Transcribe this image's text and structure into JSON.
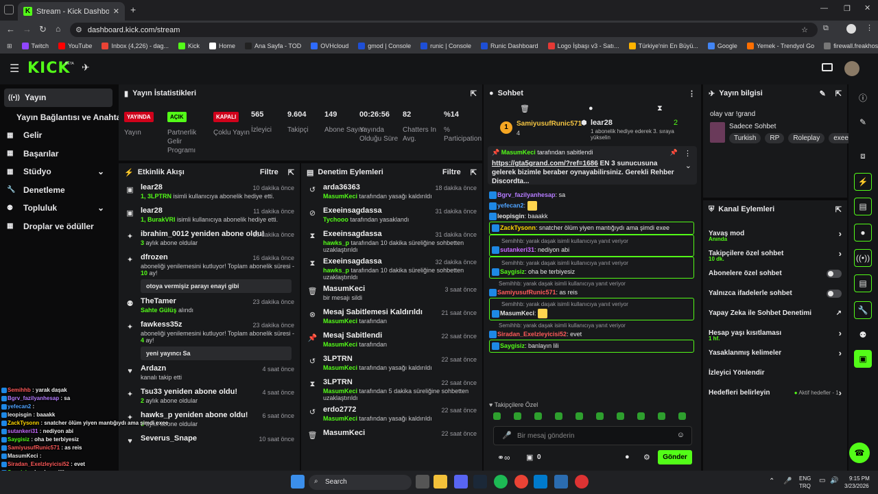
{
  "browser": {
    "tab_title": "Stream - Kick Dashboard",
    "url": "dashboard.kick.com/stream",
    "bookmarks": [
      {
        "label": "Twitch",
        "color": "#9146ff"
      },
      {
        "label": "YouTube",
        "color": "#ff0000"
      },
      {
        "label": "Inbox (4,226) - dag...",
        "color": "#ea4335"
      },
      {
        "label": "Kick",
        "color": "#53fc18"
      },
      {
        "label": "Home",
        "color": "#ffffff"
      },
      {
        "label": "Ana Sayfa - TOD",
        "color": "#222222"
      },
      {
        "label": "OVHcloud",
        "color": "#2e6bff"
      },
      {
        "label": "gmod | Console",
        "color": "#1e4fd6"
      },
      {
        "label": "runic | Console",
        "color": "#1e4fd6"
      },
      {
        "label": "Runic Dashboard",
        "color": "#1e4fd6"
      },
      {
        "label": "Logo İşbaşı v3 - Satı...",
        "color": "#e53935"
      },
      {
        "label": "Türkiye'nin En Büyü...",
        "color": "#ffb300"
      },
      {
        "label": "Google",
        "color": "#4285f4"
      },
      {
        "label": "Yemek - Trendyol Go",
        "color": "#ff6f00"
      },
      {
        "label": "firewall.freakhosting...",
        "color": "#777777"
      }
    ]
  },
  "topnav": {
    "logo": "KICK",
    "beta": "BETA"
  },
  "sidenav": {
    "items": [
      {
        "label": "Yayın",
        "icon": "broadcast-icon"
      },
      {
        "label": "Yayın Bağlantısı ve Anahtarı",
        "icon": ""
      },
      {
        "label": "Gelir",
        "icon": "revenue-icon"
      },
      {
        "label": "Başarılar",
        "icon": "achievements-icon"
      },
      {
        "label": "Stüdyo",
        "icon": "studio-icon"
      },
      {
        "label": "Denetleme",
        "icon": "moderation-icon"
      },
      {
        "label": "Topluluk",
        "icon": "community-icon"
      },
      {
        "label": "Droplar ve ödüller",
        "icon": "drops-icon"
      }
    ]
  },
  "stats": {
    "title": "Yayın İstatistikleri",
    "status": [
      {
        "badge": "YAYINDA",
        "label": "Yayın",
        "color": "#d0021b"
      },
      {
        "badge": "AÇIK",
        "label": "Partnerlik Gelir Programı",
        "color": "#53fc18"
      },
      {
        "badge": "KAPALI",
        "label": "Çoklu Yayın",
        "color": "#d0021b"
      }
    ],
    "metrics": [
      {
        "value": "565",
        "label": "İzleyici"
      },
      {
        "value": "9.604",
        "label": "Takipçi"
      },
      {
        "value": "149",
        "label": "Abone Sayısı"
      },
      {
        "value": "00:26:56",
        "label": "Yayında Olduğu Süre"
      },
      {
        "value": "82",
        "label": "Chatters In Avg."
      },
      {
        "value": "%14",
        "label": "% Participation"
      }
    ]
  },
  "activity": {
    "title": "Etkinlik Akışı",
    "filter": "Filtre",
    "items": [
      {
        "icon": "gift-icon",
        "name": "lear28",
        "time": "10 dakika önce",
        "hl": "1, 3LPTRN",
        "sub": " isimli kullanıcıya abonelik hediye etti."
      },
      {
        "icon": "gift-icon",
        "name": "lear28",
        "time": "11 dakika önce",
        "hl": "1, BurakVRI",
        "sub": " isimli kullanıcıya abonelik hediye etti."
      },
      {
        "icon": "star-icon",
        "name": "ibrahim_0012 yeniden abone oldu!",
        "time": "15 dakika önce",
        "hl": "3",
        "sub": " aylık abone oldular"
      },
      {
        "icon": "star-icon",
        "name": "dfrozen",
        "time": "16 dakika önce",
        "pre": "aboneliği yenilemesini kutluyor! Toplam abonelik süresi - ",
        "hl": "10",
        "sub": " ay!",
        "quote": "otoya vermişiz parayı enayi gibi"
      },
      {
        "icon": "kick-icon",
        "name": "TheTamer",
        "time": "23 dakika önce",
        "hl": "Sahte Gülüş",
        "sub": " alındı"
      },
      {
        "icon": "star-icon",
        "name": "fawkess35z",
        "time": "23 dakika önce",
        "pre": "aboneliği yenilemesini kutluyor! Toplam abonelik süresi - ",
        "hl": "4",
        "sub": " ay!",
        "quote": "yeni yayıncı Sa"
      },
      {
        "icon": "heart-icon",
        "name": "Ardazn",
        "time": "4 saat önce",
        "pre": "kanalı takip etti"
      },
      {
        "icon": "star-icon",
        "name": "Tsu33 yeniden abone oldu!",
        "time": "4 saat önce",
        "hl": "2",
        "sub": " aylık abone oldular"
      },
      {
        "icon": "star-icon",
        "name": "hawks_p yeniden abone oldu!",
        "time": "6 saat önce",
        "hl": "3",
        "sub": " aylık abone oldular"
      },
      {
        "icon": "heart-icon",
        "name": "Severus_Snape",
        "time": "10 saat önce"
      }
    ]
  },
  "modlog": {
    "title": "Denetim Eylemleri",
    "filter": "Filtre",
    "items": [
      {
        "icon": "undo-icon",
        "name": "arda36363",
        "time": "18 dakika önce",
        "hl": "MasumKeci",
        "sub": " tarafından yasağı kaldırıldı"
      },
      {
        "icon": "ban-icon",
        "name": "Exeeinsagdassa",
        "time": "31 dakika önce",
        "hl": "Tychooo",
        "sub": " tarafından yasaklandı"
      },
      {
        "icon": "hourglass-icon",
        "name": "Exeeinsagdassa",
        "time": "31 dakika önce",
        "hl": "hawks_p",
        "sub": " tarafından 10 dakika süreliğine sohbetten uzaklaştırıldı"
      },
      {
        "icon": "hourglass-icon",
        "name": "Exeeinsagdassa",
        "time": "32 dakika önce",
        "hl": "hawks_p",
        "sub": " tarafından 10 dakika süreliğine sohbetten uzaklaştırıldı"
      },
      {
        "icon": "trash-icon",
        "name": "MasumKeci",
        "time": "3 saat önce",
        "pre": "bir mesajı sildi"
      },
      {
        "icon": "unpin-icon",
        "name": "Mesaj Sabitlemesi Kaldırıldı",
        "time": "21 saat önce",
        "hl": "MasumKeci",
        "sub": " tarafından"
      },
      {
        "icon": "pin-icon",
        "name": "Mesaj Sabitlendi",
        "time": "22 saat önce",
        "hl": "MasumKeci",
        "sub": " tarafından"
      },
      {
        "icon": "undo-icon",
        "name": "3LPTRN",
        "time": "22 saat önce",
        "hl": "MasumKeci",
        "sub": " tarafından yasağı kaldırıldı"
      },
      {
        "icon": "hourglass-icon",
        "name": "3LPTRN",
        "time": "22 saat önce",
        "hl": "MasumKeci",
        "sub": " tarafından 5 dakika süreliğine sohbetten uzaklaştırıldı"
      },
      {
        "icon": "undo-icon",
        "name": "erdo2772",
        "time": "22 saat önce",
        "hl": "MasumKeci",
        "sub": " tarafından yasağı kaldırıldı"
      },
      {
        "icon": "trash-icon",
        "name": "MasumKeci",
        "time": "22 saat önce"
      }
    ]
  },
  "chat": {
    "title": "Sohbet",
    "top_gifter": {
      "name": "SamiyusufRunic571",
      "rank": "1",
      "count": "4"
    },
    "gift_event": {
      "name": "lear28",
      "count": "2",
      "text": "1 abonelik hediye ederek 3. sıraya yükselin"
    },
    "pinned": {
      "by": "MasumKeci",
      "label": " tarafından sabitlendi",
      "link": "https://gta5grand.com/?ref=1686",
      "text": " EN 3 sunucusuna gelerek bizimle beraber oynayabilirsiniz. Gerekli Rehber Discordta..."
    },
    "messages": [
      {
        "user": "Bgrv_fazilyanhesap",
        "color": "#b57cff",
        "text": "sa"
      },
      {
        "user": "yefecan2",
        "color": "#4fa3ff",
        "text": "",
        "emote": true
      },
      {
        "user": "leopisgin",
        "color": "#e6e6e6",
        "text": "baaakk"
      },
      {
        "user": "ZackTysonn",
        "color": "#ffd700",
        "text": "snatcher ölüm yiyen mantığıydı ama şimdi exee",
        "highlight": true
      },
      {
        "reply": "Semihhb: yarak daşak isimli kullanıcıya yanıt veriyor",
        "user": "sutankeri31",
        "color": "#c86bff",
        "text": "nediyon abi",
        "highlight": true
      },
      {
        "reply": "Semihhb: yarak daşak isimli kullanıcıya yanıt veriyor",
        "user": "Saygisiz",
        "color": "#53fc18",
        "text": "oha be terbiyesiz",
        "highlight": true
      },
      {
        "reply": "Semihhb: yarak daşak isimli kullanıcıya yanıt veriyor",
        "user": "SamiyusufRunic571",
        "color": "#ff5a5a",
        "text": "as reis"
      },
      {
        "reply": "Semihhb: yarak daşak isimli kullanıcıya yanıt veriyor",
        "user": "MasumKeci",
        "color": "#e6e6e6",
        "text": "",
        "emote": true,
        "highlight": true
      },
      {
        "reply": "Semihhb: yarak daşak isimli kullanıcıya yanıt veriyor",
        "user": "Siradan_Exelzleyicisi52",
        "color": "#ff5a5a",
        "text": "evet"
      },
      {
        "user": "Saygisiz",
        "color": "#53fc18",
        "text": "banlayın lili",
        "highlight": true
      }
    ],
    "emote_section": "Takipçilere Özel",
    "input_placeholder": "Bir mesaj gönderin",
    "points": "0",
    "send": "Gönder"
  },
  "stream_info": {
    "title": "Yayın bilgisi",
    "stream_title": "olay var !grand",
    "category": "Sadece Sohbet",
    "tags": [
      "Turkish",
      "RP",
      "Roleplay",
      "exee"
    ]
  },
  "channel_actions": {
    "title": "Kanal Eylemleri",
    "items": [
      {
        "label": "Yavaş mod",
        "sub": "Anında",
        "type": "chevron"
      },
      {
        "label": "Takipçilere özel sohbet",
        "sub": "10 dk.",
        "type": "chevron"
      },
      {
        "label": "Abonelere özel sohbet",
        "type": "toggle"
      },
      {
        "label": "Yalnızca ifadelerle sohbet",
        "type": "toggle"
      },
      {
        "label": "Yapay Zeka ile Sohbet Denetimi",
        "type": "external"
      },
      {
        "label": "Hesap yaşı kısıtlaması",
        "sub": "1 hf.",
        "type": "chevron"
      },
      {
        "label": "Yasaklanmış kelimeler",
        "type": "chevron"
      },
      {
        "label": "İzleyici Yönlendir",
        "type": "none"
      },
      {
        "label": "Hedefleri belirleyin",
        "type": "goal",
        "extra": "Aktif hedefler - 1"
      }
    ]
  },
  "overlay": {
    "lines": [
      {
        "user": "Semihhb",
        "ucolor": "#ff5a5a",
        "text": "yarak daşak"
      },
      {
        "user": "Bgrv_fazilyanhesap",
        "ucolor": "#b57cff",
        "text": "sa"
      },
      {
        "user": "yefecan2",
        "ucolor": "#4fa3ff",
        "text": ""
      },
      {
        "user": "leopisgin",
        "ucolor": "#e6e6e6",
        "text": "baaakk"
      },
      {
        "user": "ZackTysonn",
        "ucolor": "#ffd700",
        "text": "snatcher ölüm yiyen mantığıydı ama şimdi exee"
      },
      {
        "user": "sutankeri31",
        "ucolor": "#c86bff",
        "text": "nediyon abi"
      },
      {
        "user": "Saygisiz",
        "ucolor": "#53fc18",
        "text": "oha be terbiyesiz"
      },
      {
        "user": "SamiyusufRunic571",
        "ucolor": "#ff5a5a",
        "text": "as reis"
      },
      {
        "user": "MasumKeci",
        "ucolor": "#e6e6e6",
        "text": ""
      },
      {
        "user": "Siradan_Exelzleyicisi52",
        "ucolor": "#ff5a5a",
        "text": "evet"
      },
      {
        "user": "Saygisiz",
        "ucolor": "#53fc18",
        "text": "banlayın lili"
      }
    ]
  },
  "taskbar": {
    "search": "Search",
    "lang1": "ENG",
    "lang2": "TRQ",
    "time": "9:15 PM",
    "date": "3/23/2026"
  }
}
